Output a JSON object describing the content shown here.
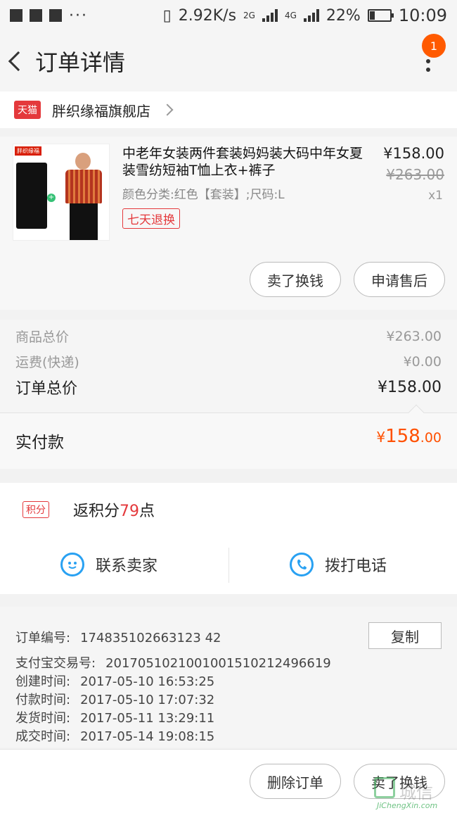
{
  "status_bar": {
    "dots": "···",
    "net_speed": "2.92K/s",
    "sim1": "2G",
    "sim2": "4G",
    "battery": "22%",
    "time": "10:09"
  },
  "header": {
    "title": "订单详情",
    "notification_count": "1"
  },
  "shop": {
    "badge": "天猫",
    "name": "胖织缘福旗舰店"
  },
  "product": {
    "image_tag": "胖织缘福",
    "title": "中老年女装两件套装妈妈装大码中年女夏装雪纺短袖T恤上衣+裤子",
    "variant": "颜色分类:红色【套装】;尺码:L",
    "return_policy": "七天退换",
    "price": "¥158.00",
    "original_price": "¥263.00",
    "quantity": "x1",
    "actions": {
      "sell": "卖了换钱",
      "after_sale": "申请售后"
    }
  },
  "totals": {
    "goods_label": "商品总价",
    "goods_value": "¥263.00",
    "shipping_label": "运费(快递)",
    "shipping_value": "¥0.00",
    "order_label": "订单总价",
    "order_value": "¥158.00",
    "paid_label": "实付款",
    "paid_yuan": "¥",
    "paid_int": "158",
    "paid_dec": ".00"
  },
  "points": {
    "badge": "积分",
    "prefix": "返积分",
    "value": "79",
    "suffix": "点"
  },
  "contact": {
    "seller": "联系卖家",
    "call": "拨打电话"
  },
  "order_info": {
    "copy_label": "复制",
    "order_no_label": "订单编号:",
    "order_no": "174835102663123 42",
    "alipay_label": "支付宝交易号:",
    "alipay_no": "2017051021001001510212496619",
    "created_label": "创建时间:",
    "created": "2017-05-10 16:53:25",
    "paid_label": "付款时间:",
    "paid": "2017-05-10 17:07:32",
    "shipped_label": "发货时间:",
    "shipped": "2017-05-11 13:29:11",
    "completed_label": "成交时间:",
    "completed": "2017-05-14 19:08:15"
  },
  "bottom": {
    "delete": "删除订单",
    "sell": "卖了换钱"
  },
  "watermark": {
    "text": "城信",
    "sub": "JiChengXin.com"
  },
  "colors": {
    "accent": "#ff5000",
    "tmall_red": "#e4393c",
    "contact_blue": "#29a1f2"
  }
}
